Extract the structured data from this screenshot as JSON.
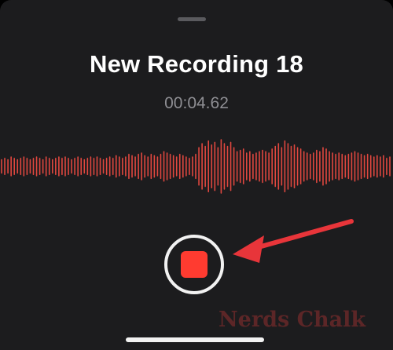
{
  "recording": {
    "title": "New Recording 18",
    "elapsed": "00:04.62"
  },
  "waveform": {
    "color": "#e0473f",
    "amplitudes": [
      0.25,
      0.3,
      0.25,
      0.35,
      0.3,
      0.25,
      0.3,
      0.35,
      0.3,
      0.25,
      0.3,
      0.35,
      0.3,
      0.25,
      0.35,
      0.3,
      0.25,
      0.3,
      0.35,
      0.3,
      0.35,
      0.3,
      0.25,
      0.3,
      0.35,
      0.3,
      0.25,
      0.3,
      0.35,
      0.3,
      0.35,
      0.3,
      0.25,
      0.3,
      0.35,
      0.3,
      0.4,
      0.35,
      0.3,
      0.35,
      0.45,
      0.4,
      0.35,
      0.45,
      0.5,
      0.4,
      0.35,
      0.45,
      0.4,
      0.35,
      0.45,
      0.55,
      0.5,
      0.45,
      0.4,
      0.35,
      0.45,
      0.4,
      0.35,
      0.3,
      0.35,
      0.45,
      0.7,
      0.85,
      0.75,
      0.95,
      0.8,
      0.9,
      0.7,
      1.0,
      0.85,
      0.75,
      0.9,
      0.7,
      0.55,
      0.6,
      0.65,
      0.5,
      0.55,
      0.45,
      0.5,
      0.55,
      0.6,
      0.55,
      0.5,
      0.65,
      0.75,
      0.85,
      0.7,
      0.95,
      0.85,
      0.75,
      0.8,
      0.7,
      0.65,
      0.55,
      0.5,
      0.45,
      0.5,
      0.6,
      0.55,
      0.7,
      0.65,
      0.55,
      0.5,
      0.45,
      0.5,
      0.45,
      0.4,
      0.45,
      0.5,
      0.55,
      0.5,
      0.45,
      0.4,
      0.45,
      0.4,
      0.35,
      0.4,
      0.35,
      0.4,
      0.3,
      0.35
    ]
  },
  "controls": {
    "stop_button_ring": "#f2f2f2",
    "stop_button_fill": "#ff3b30"
  },
  "annotation": {
    "arrow_color": "#e8353a"
  },
  "watermark": {
    "text": "Nerds Chalk"
  }
}
